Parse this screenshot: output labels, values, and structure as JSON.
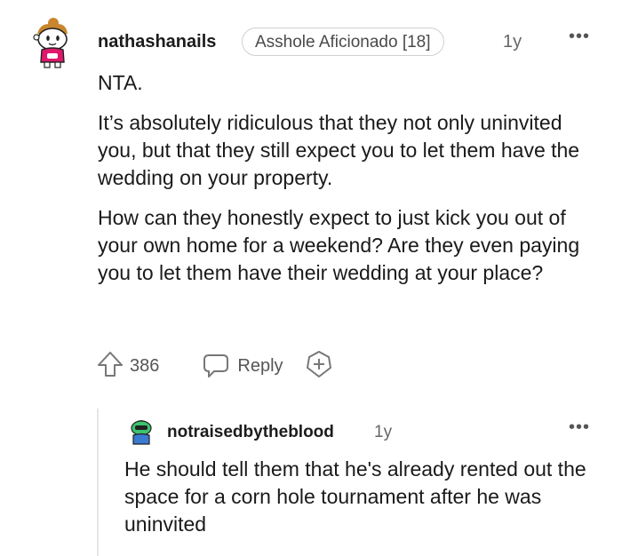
{
  "comment": {
    "username": "nathashanails",
    "flair": "Asshole Aficionado [18]",
    "age": "1y",
    "more": "•••",
    "paragraphs": [
      "NTA.",
      "It’s absolutely ridiculous that they not only uninvited you, but that they still expect you to let them have the wedding on your property.",
      "How can they honestly expect to just kick you out of your own home for a weekend? Are they even paying you to let them have their wedding at your place?"
    ],
    "vote_count": "386",
    "reply_label": "Reply",
    "icons": {
      "upvote": "arrow-up-icon",
      "reply": "speech-bubble-icon",
      "award": "plus-circle-icon"
    }
  },
  "reply": {
    "username": "notraisedbytheblood",
    "age": "1y",
    "more": "•••",
    "text": "He should tell them that he's already rented out the space for a corn hole tournament after he was uninvited"
  },
  "colors": {
    "text": "#1a1a1b",
    "muted": "#555555",
    "border": "#d0d0d0",
    "avatar_pink": "#e0186c",
    "avatar_green": "#3cc46e"
  }
}
